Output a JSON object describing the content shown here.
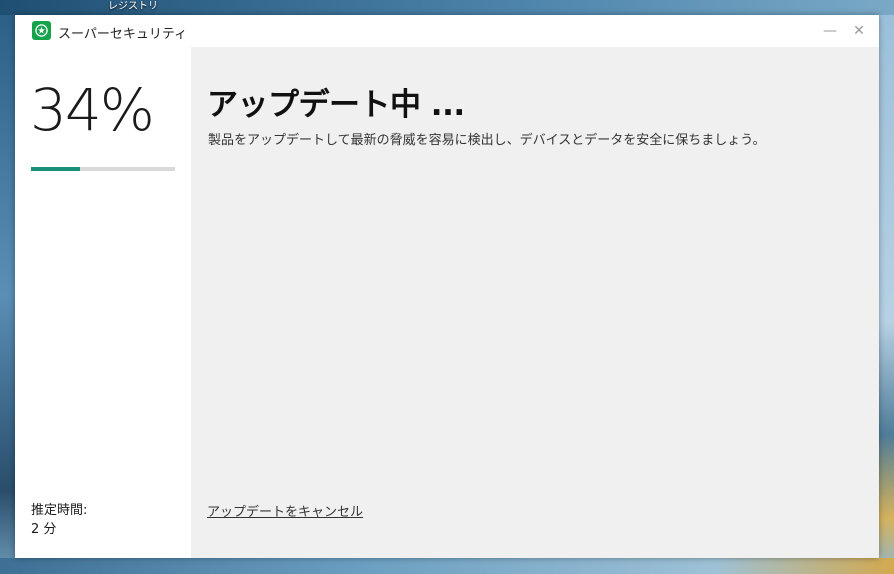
{
  "desktop": {
    "icon_label": "レジストリ"
  },
  "window": {
    "title": "スーパーセキュリティ",
    "logo_icon": "shield-star-icon",
    "brand_color": "#14a34a",
    "minimize_glyph": "—",
    "close_glyph": "✕"
  },
  "progress": {
    "percent_label": "34%",
    "value": 0.34,
    "fill_color": "#1a8e78",
    "estimate_label": "推定時間:",
    "estimate_value": "2 分"
  },
  "main": {
    "heading": "アップデート中 ...",
    "subtitle": "製品をアップデートして最新の脅威を容易に検出し、デバイスとデータを安全に保ちましょう。",
    "cancel_link": "アップデートをキャンセル"
  }
}
